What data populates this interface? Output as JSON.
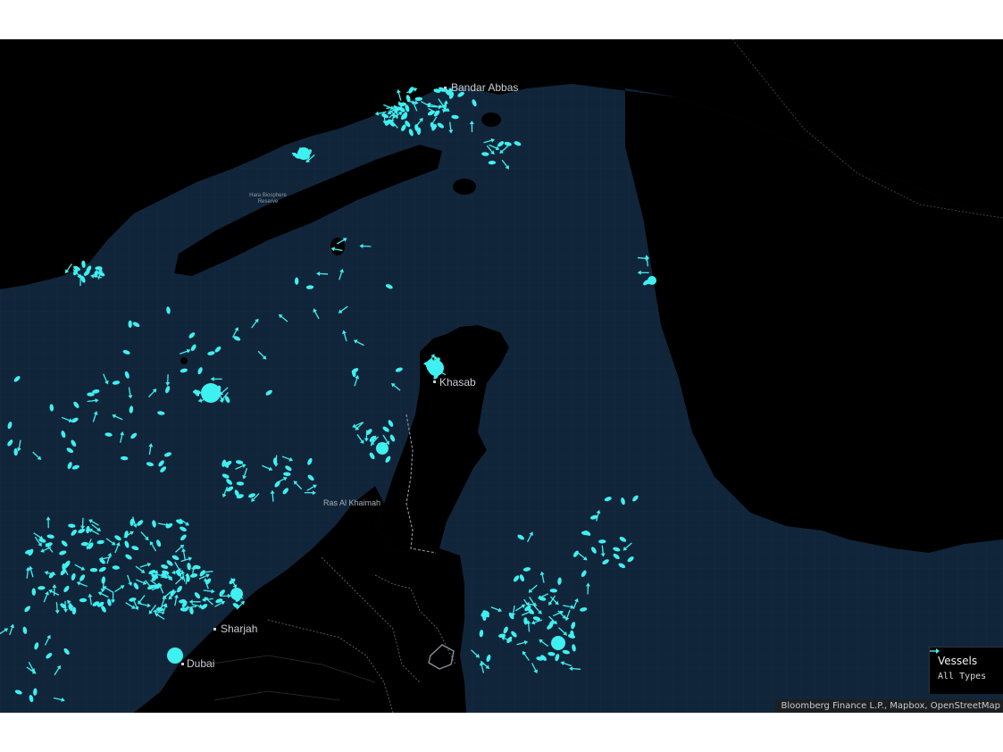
{
  "map": {
    "places": [
      {
        "id": "bandar-abbas",
        "name": "Bandar Abbas"
      },
      {
        "id": "khasab",
        "name": "Khasab"
      },
      {
        "id": "ras-al-khaimah",
        "name": "Ras Al Khaimah"
      },
      {
        "id": "sharjah",
        "name": "Sharjah"
      },
      {
        "id": "dubai",
        "name": "Dubai"
      },
      {
        "id": "hara-reserve",
        "name": "Hara Biosphere Reserve"
      }
    ],
    "colors": {
      "sea": "#11253a",
      "land": "#000000",
      "vessel": "#3ff0f0",
      "border": "#8a8f94"
    }
  },
  "legend": {
    "title": "Vessels",
    "items": [
      {
        "label": "All Types",
        "icon": "vessel-arrow-icon",
        "color": "#3ff0f0"
      }
    ]
  },
  "attribution": "Bloomberg Finance L.P., Mapbox, OpenStreetMap"
}
